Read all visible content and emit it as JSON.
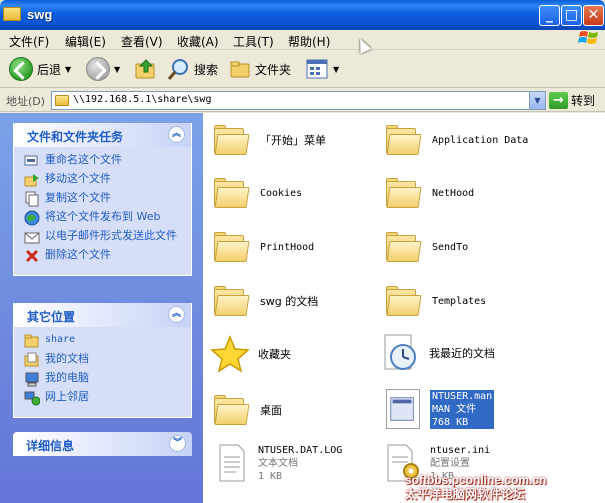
{
  "window": {
    "title": "swg",
    "min_symbol": "_",
    "max_symbol": "□",
    "close_symbol": "✕"
  },
  "menu": [
    "文件(F)",
    "编辑(E)",
    "查看(V)",
    "收藏(A)",
    "工具(T)",
    "帮助(H)"
  ],
  "toolbar": {
    "back_label": "后退",
    "search_label": "搜索",
    "folders_label": "文件夹"
  },
  "address": {
    "label": "地址(D)",
    "value": "\\\\192.168.5.1\\share\\swg",
    "go_label": "转到"
  },
  "tasks_panel": {
    "title": "文件和文件夹任务",
    "items": [
      {
        "label": "重命名这个文件",
        "icon": "rename-icon"
      },
      {
        "label": "移动这个文件",
        "icon": "move-icon"
      },
      {
        "label": "复制这个文件",
        "icon": "copy-icon"
      },
      {
        "label": "将这个文件发布到 Web",
        "icon": "web-publish-icon"
      },
      {
        "label": "以电子邮件形式发送此文件",
        "icon": "email-icon"
      },
      {
        "label": "删除这个文件",
        "icon": "delete-icon"
      }
    ]
  },
  "places_panel": {
    "title": "其它位置",
    "items": [
      {
        "label": "share",
        "icon": "folder-icon"
      },
      {
        "label": "我的文档",
        "icon": "my-documents-icon"
      },
      {
        "label": "我的电脑",
        "icon": "my-computer-icon"
      },
      {
        "label": "网上邻居",
        "icon": "network-icon"
      }
    ]
  },
  "details_panel": {
    "title": "详细信息"
  },
  "files": [
    {
      "name": "「开始」菜单",
      "type": "folder"
    },
    {
      "name": "Application Data",
      "type": "folder"
    },
    {
      "name": "Cookies",
      "type": "folder"
    },
    {
      "name": "NetHood",
      "type": "folder"
    },
    {
      "name": "PrintHood",
      "type": "folder"
    },
    {
      "name": "SendTo",
      "type": "folder"
    },
    {
      "name": "swg 的文档",
      "type": "folder"
    },
    {
      "name": "Templates",
      "type": "folder"
    },
    {
      "name": "收藏夹",
      "type": "favorites"
    },
    {
      "name": "我最近的文档",
      "type": "recent"
    },
    {
      "name": "桌面",
      "type": "folder"
    },
    {
      "name": "NTUSER.man",
      "line2": "MAN 文件",
      "line3": "768 KB",
      "type": "file",
      "selected": true
    },
    {
      "name": "NTUSER.DAT.LOG",
      "line2": "文本文档",
      "line3": "1 KB",
      "type": "text"
    },
    {
      "name": "ntuser.ini",
      "line2": "配置设置",
      "line3": "1 KB",
      "type": "ini"
    }
  ],
  "watermark": {
    "line1": "softbbs.pconline.com.cn",
    "line2": "太平洋电脑网软件论坛"
  }
}
